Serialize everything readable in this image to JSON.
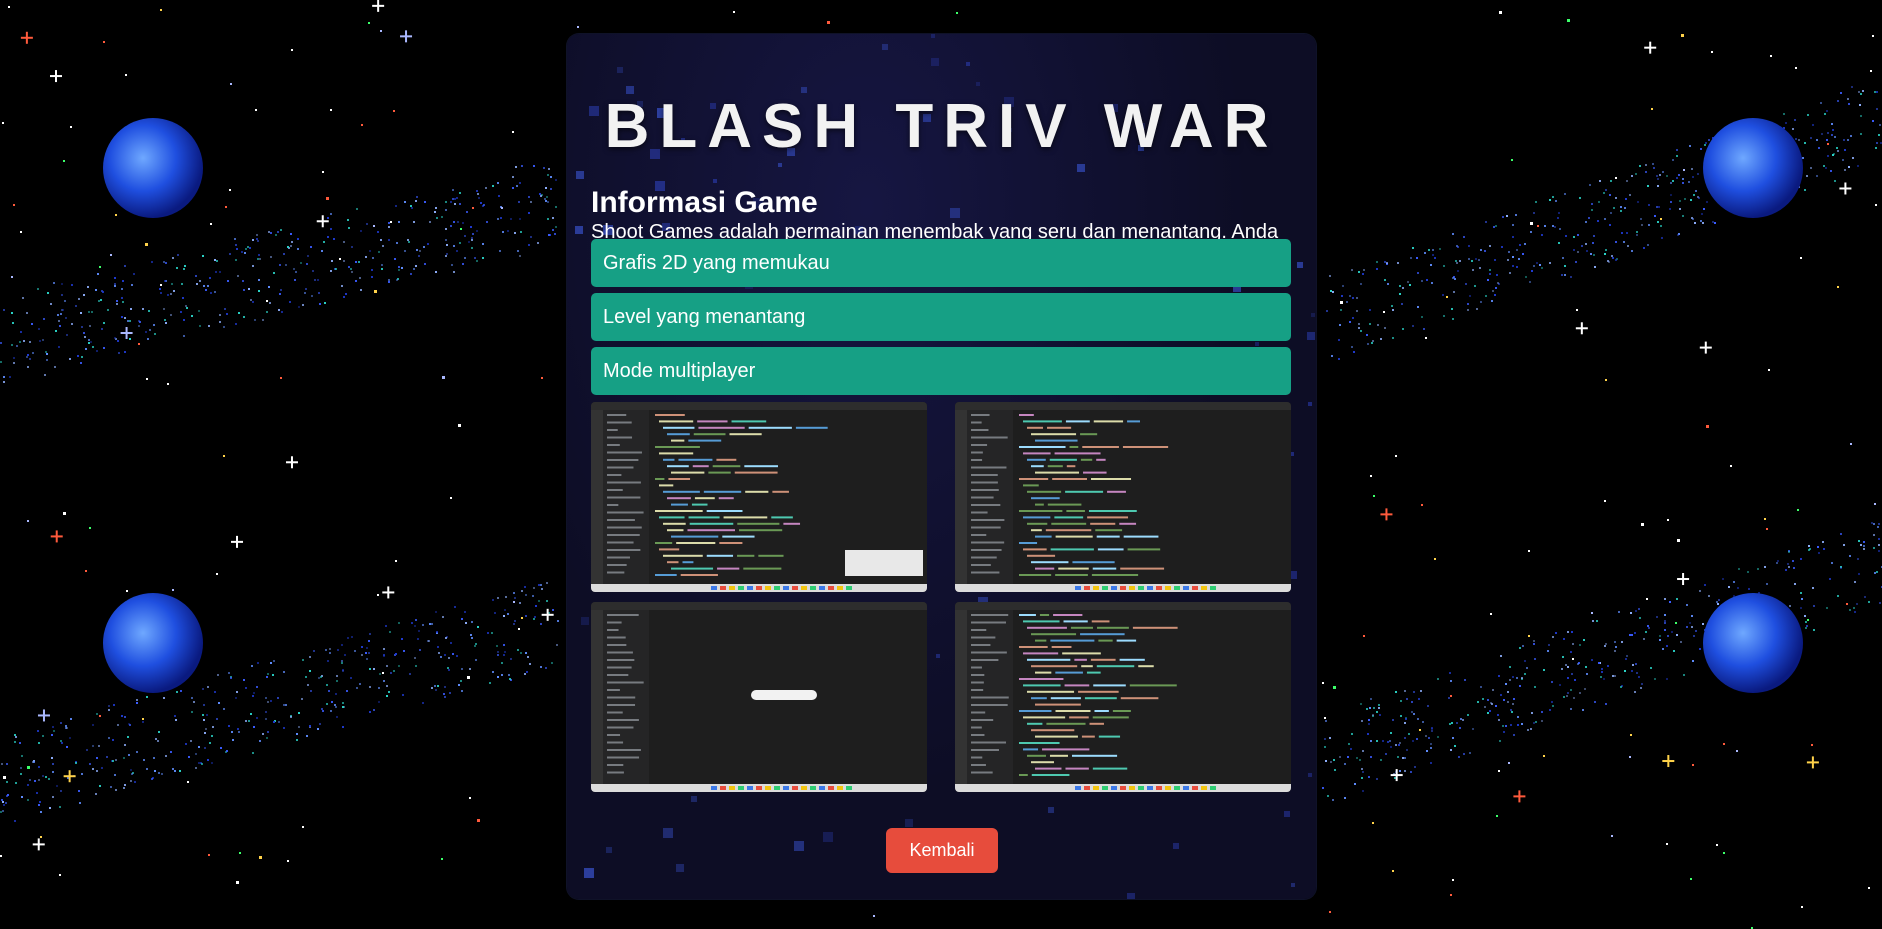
{
  "game": {
    "title": "BLASH TRIV WAR"
  },
  "info": {
    "heading": "Informasi Game",
    "description": "Shoot Games adalah permainan menembak yang seru dan menantang. Anda akan menghadapi berbagai musuh dan rintangan di setiap level."
  },
  "features": [
    {
      "label": "Grafis 2D yang memukau"
    },
    {
      "label": "Level yang menantang"
    },
    {
      "label": "Mode multiplayer"
    }
  ],
  "screenshots": [
    {
      "icon": "code-editor-screenshot"
    },
    {
      "icon": "code-editor-screenshot"
    },
    {
      "icon": "code-editor-screenshot"
    },
    {
      "icon": "code-editor-screenshot"
    }
  ],
  "actions": {
    "back_label": "Kembali"
  },
  "colors": {
    "feature_bg": "#16a085",
    "back_button_bg": "#e74c3c",
    "panel_bg": "#0e0e28",
    "background": "#000000"
  }
}
